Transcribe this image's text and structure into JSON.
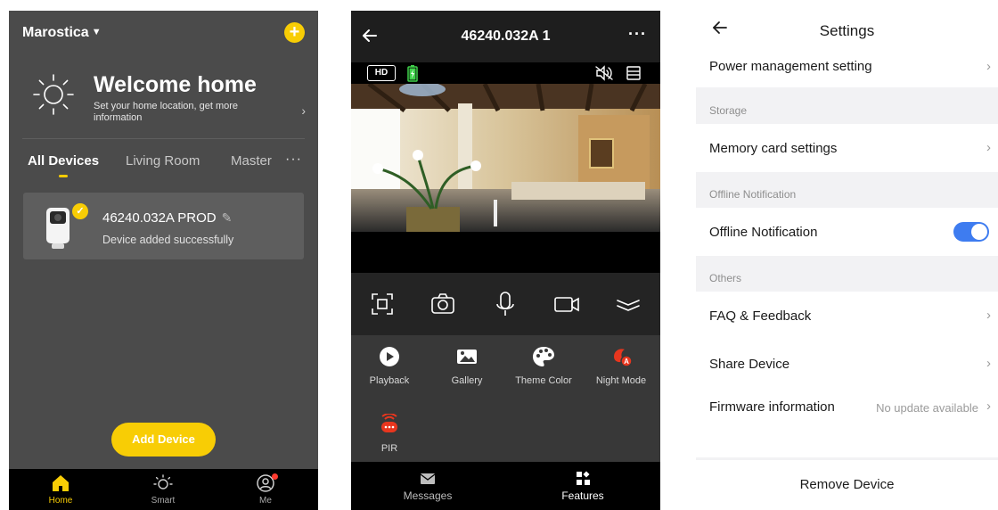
{
  "home": {
    "location": "Marostica",
    "welcome_title": "Welcome home",
    "welcome_subtitle": "Set your home location, get more information",
    "tabs": [
      "All Devices",
      "Living Room",
      "Master"
    ],
    "more_label": "···",
    "device": {
      "name": "46240.032A PROD",
      "status": "Device added successfully"
    },
    "add_device_label": "Add Device",
    "tabbar": [
      "Home",
      "Smart",
      "Me"
    ],
    "accent_color": "#f8cd05"
  },
  "camera": {
    "title": "46240.032A 1",
    "more_label": "···",
    "hd_label": "HD",
    "controls": [
      "fullscreen-icon",
      "camera-icon",
      "microphone-icon",
      "video-record-icon",
      "collapse-icon"
    ],
    "features": [
      "Playback",
      "Gallery",
      "Theme Color",
      "Night Mode",
      "PIR"
    ],
    "tabs": [
      "Messages",
      "Features"
    ],
    "accent_color": "#e8361e"
  },
  "settings": {
    "title": "Settings",
    "rows": {
      "power": "Power management setting",
      "storage_header": "Storage",
      "memory": "Memory card settings",
      "offline_header": "Offline Notification",
      "offline": "Offline Notification",
      "offline_enabled": true,
      "others_header": "Others",
      "faq": "FAQ & Feedback",
      "share": "Share Device",
      "firmware": "Firmware information",
      "firmware_value": "No update available"
    },
    "remove_label": "Remove Device",
    "toggle_color": "#3e7cf0"
  }
}
